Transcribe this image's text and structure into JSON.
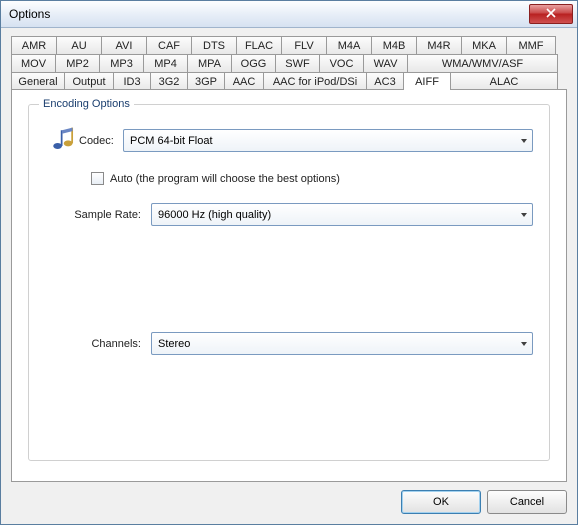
{
  "window": {
    "title": "Options"
  },
  "tabs": {
    "row1": [
      "AMR",
      "AU",
      "AVI",
      "CAF",
      "DTS",
      "FLAC",
      "FLV",
      "M4A",
      "M4B",
      "M4R",
      "MKA",
      "MMF"
    ],
    "row2": [
      "MOV",
      "MP2",
      "MP3",
      "MP4",
      "MPA",
      "OGG",
      "SWF",
      "VOC",
      "WAV",
      "WMA/WMV/ASF"
    ],
    "row3": [
      "General",
      "Output",
      "ID3",
      "3G2",
      "3GP",
      "AAC",
      "AAC for iPod/DSi",
      "AC3",
      "AIFF",
      "ALAC"
    ],
    "active": "AIFF"
  },
  "group": {
    "legend": "Encoding Options"
  },
  "codec": {
    "label": "Codec:",
    "value": "PCM 64-bit Float"
  },
  "auto": {
    "label": "Auto (the program will choose the best options)",
    "checked": false
  },
  "sample_rate": {
    "label": "Sample Rate:",
    "value": "96000 Hz (high quality)"
  },
  "channels": {
    "label": "Channels:",
    "value": "Stereo"
  },
  "buttons": {
    "ok": "OK",
    "cancel": "Cancel"
  }
}
